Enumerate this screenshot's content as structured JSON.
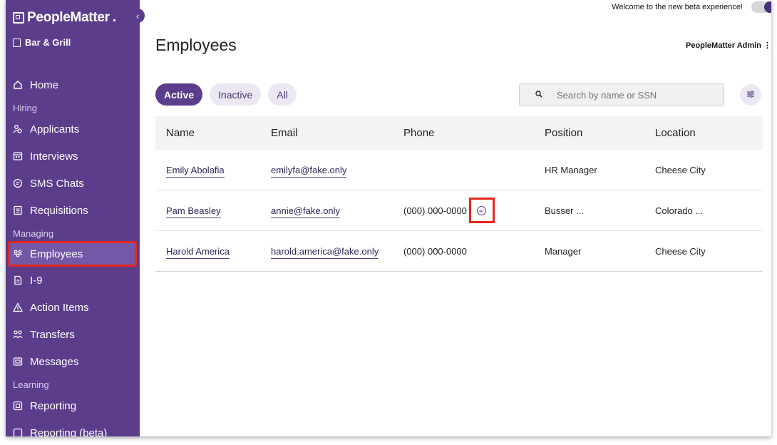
{
  "sidebar": {
    "brand": "PeopleMatter",
    "brand_dot": ".",
    "collapse_icon": "chevron-left-icon",
    "location": "Bar & Grill",
    "items": [
      {
        "label": "Home",
        "icon": "home-icon"
      },
      {
        "section": "Hiring"
      },
      {
        "label": "Applicants",
        "icon": "applicants-icon"
      },
      {
        "label": "Interviews",
        "icon": "calendar-icon"
      },
      {
        "label": "SMS Chats",
        "icon": "chat-icon"
      },
      {
        "label": "Requisitions",
        "icon": "document-icon"
      },
      {
        "section": "Managing"
      },
      {
        "label": "Employees",
        "icon": "employees-icon",
        "active": true
      },
      {
        "label": "I-9",
        "icon": "file-icon"
      },
      {
        "label": "Action Items",
        "icon": "warning-icon"
      },
      {
        "label": "Transfers",
        "icon": "transfers-icon"
      },
      {
        "label": "Messages",
        "icon": "messages-icon"
      },
      {
        "section": "Learning"
      },
      {
        "label": "Reporting",
        "icon": "reporting-icon"
      },
      {
        "label": "Reporting (beta)",
        "icon": "reporting-icon"
      }
    ]
  },
  "header": {
    "beta_text": "Welcome to the new beta experience!",
    "page_title": "Employees",
    "admin": "PeopleMatter Admin"
  },
  "filters": {
    "active": "Active",
    "inactive": "Inactive",
    "all": "All"
  },
  "search": {
    "placeholder": "Search by name or SSN"
  },
  "table": {
    "headers": [
      "Name",
      "Email",
      "Phone",
      "Position",
      "Location"
    ],
    "rows": [
      {
        "name": "Emily Abolafia",
        "email": "emilyfa@fake.only",
        "phone": "",
        "position": "HR Manager",
        "location": "Cheese City"
      },
      {
        "name": "Pam Beasley",
        "email": "annie@fake.only",
        "phone": "(000) 000-0000",
        "position": "Busser ...",
        "location": "Colorado ..."
      },
      {
        "name": "Harold America",
        "email": "harold.america@fake.only",
        "phone": "(000) 000-0000",
        "position": "Manager",
        "location": "Cheese City"
      }
    ]
  },
  "colors": {
    "sidebar": "#5b3d8c",
    "highlight": "#e5261f"
  }
}
